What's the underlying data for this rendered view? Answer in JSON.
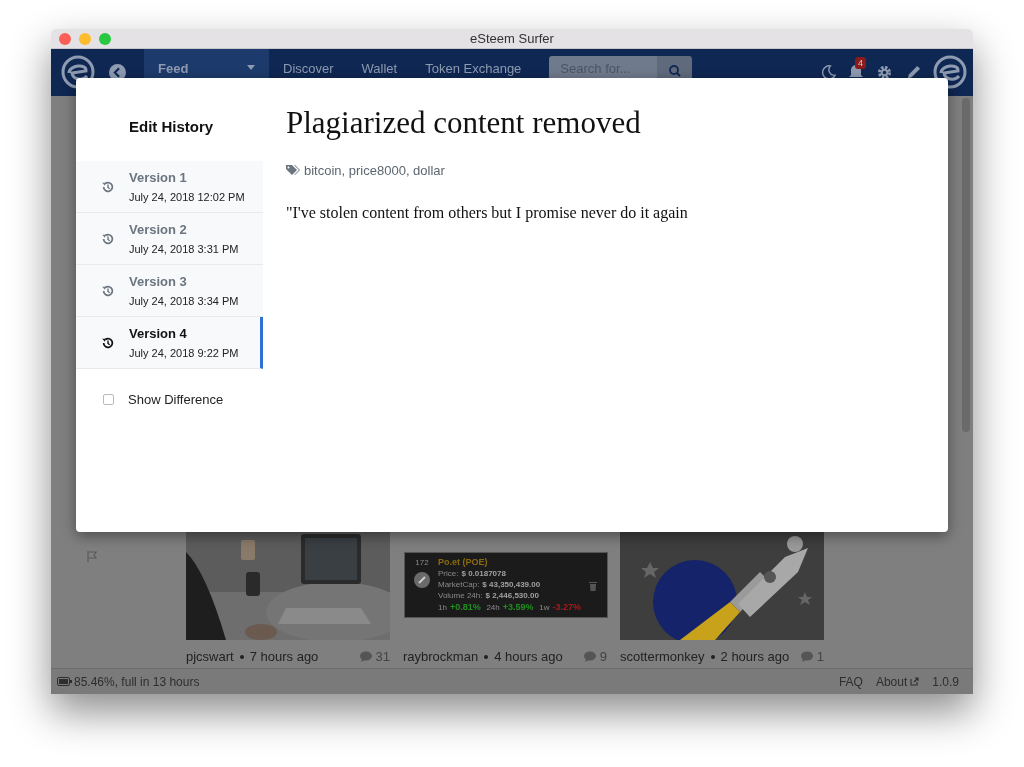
{
  "window": {
    "title": "eSteem Surfer"
  },
  "nav": {
    "items": [
      {
        "label": "Feed",
        "selected": true,
        "dropdown": true
      },
      {
        "label": "Discover",
        "selected": false,
        "dropdown": false
      },
      {
        "label": "Wallet",
        "selected": false,
        "dropdown": false
      },
      {
        "label": "Token Exchange",
        "selected": false,
        "dropdown": false
      }
    ],
    "search": {
      "placeholder": "Search for..."
    },
    "notification_count": "4"
  },
  "modal": {
    "sidebar_title": "Edit History",
    "versions": [
      {
        "label": "Version 1",
        "date": "July 24, 2018 12:02 PM",
        "selected": false
      },
      {
        "label": "Version 2",
        "date": "July 24, 2018 3:31 PM",
        "selected": false
      },
      {
        "label": "Version 3",
        "date": "July 24, 2018 3:34 PM",
        "selected": false
      },
      {
        "label": "Version 4",
        "date": "July 24, 2018 9:22 PM",
        "selected": true
      }
    ],
    "show_difference": {
      "label": "Show Difference",
      "checked": false
    },
    "title": "Plagiarized content removed",
    "tags": "bitcoin, price8000, dollar",
    "body": "\"I've stolen content from others but I promise never do it again"
  },
  "feed": [
    {
      "kind": "picture",
      "author": "pjcswart",
      "time": "7 hours ago",
      "comments": "31"
    },
    {
      "kind": "coin",
      "author": "raybrockman",
      "time": "4 hours ago",
      "comments": "9",
      "coin": {
        "rank": "172",
        "name": "Po.et (POE)",
        "rows": [
          {
            "label": "Price:",
            "value": "$ 0.0187078"
          },
          {
            "label": "MarketCap:",
            "value": "$ 43,350,439.00"
          },
          {
            "label": "Volume 24h:",
            "value": "$ 2,446,530.00"
          }
        ],
        "changes": [
          {
            "period": "1h",
            "value": "+0.81%",
            "color": "#1f8f1f"
          },
          {
            "period": "24h",
            "value": "+3.59%",
            "color": "#1f8f1f"
          },
          {
            "period": "1w",
            "value": "-3.27%",
            "color": "#a11d1d"
          }
        ]
      }
    },
    {
      "kind": "rocket",
      "author": "scottermonkey",
      "time": "2 hours ago",
      "comments": "1"
    }
  ],
  "status": {
    "battery": "85.46%, full in 13 hours",
    "links": [
      "FAQ",
      "About"
    ],
    "version": "1.0.9"
  }
}
